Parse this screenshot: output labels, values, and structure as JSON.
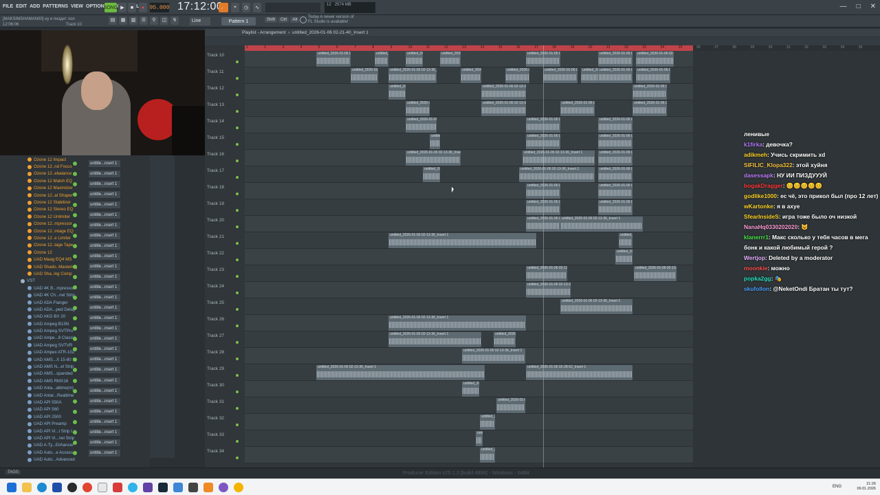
{
  "menu": [
    "FILE",
    "EDIT",
    "ADD",
    "PATTERNS",
    "VIEW",
    "OPTIONS",
    "TOOLS",
    "HELP"
  ],
  "transport": {
    "tempo": "95.000",
    "clock": "17:12:00",
    "song_label": "SONG"
  },
  "hint": {
    "line1": "[MAKSIMSHAMAN00] ну и пиздит лол",
    "line2": "12:06:06",
    "track": "Track 10"
  },
  "cpu": {
    "cpu": "12",
    "mem": "2574 MB"
  },
  "notice": {
    "line1": "Today  A newer version of",
    "line2": "FL Studio is available!"
  },
  "toolbar": {
    "pattern": "Pattern 1",
    "snap": "Line",
    "mods": [
      "Shift",
      "Ctrl",
      "Alt"
    ]
  },
  "playlist": {
    "title": "Playlist - Arrangement",
    "name": "untitled_2026-01-06 02-21-40_Insert 1"
  },
  "ruler": [
    "1",
    "2",
    "3",
    "4",
    "5",
    "6",
    "7",
    "8",
    "9",
    "10",
    "11",
    "12",
    "13",
    "14",
    "15",
    "16",
    "17",
    "18",
    "19",
    "20",
    "21",
    "22",
    "23",
    "24",
    "25",
    "26",
    "27",
    "28",
    "29",
    "30",
    "31",
    "32",
    "33",
    "34",
    "35"
  ],
  "tracks": [
    "Track 10",
    "Track 11",
    "Track 12",
    "Track 13",
    "Track 14",
    "Track 15",
    "Track 16",
    "Track 17",
    "Track 18",
    "Track 19",
    "Track 20",
    "Track 21",
    "Track 22",
    "Track 23",
    "Track 24",
    "Track 25",
    "Track 26",
    "Track 27",
    "Track 28",
    "Track 29",
    "Track 30",
    "Track 31",
    "Track 32",
    "Track 33",
    "Track 34"
  ],
  "browser_items": [
    {
      "label": "Ozone 12 Impact",
      "type": "orange"
    },
    {
      "label": "Ozone 12..nd Focus",
      "type": "orange"
    },
    {
      "label": "Ozone 12..ebalance",
      "type": "orange"
    },
    {
      "label": "Ozone 12 Match EQ",
      "type": "orange"
    },
    {
      "label": "Ozone 12 Maximizer",
      "type": "orange"
    },
    {
      "label": "Ozone 12..al Shaper",
      "type": "orange"
    },
    {
      "label": "Ozone 12 Stabilizer",
      "type": "orange"
    },
    {
      "label": "Ozone 12 Stereo EQ",
      "type": "orange"
    },
    {
      "label": "Ozone 12 Unlimiter",
      "type": "orange"
    },
    {
      "label": "Ozone 12..mpressor",
      "type": "orange"
    },
    {
      "label": "Ozone 12..intage EQ",
      "type": "orange"
    },
    {
      "label": "Ozone 12..e Limiter",
      "type": "orange"
    },
    {
      "label": "Ozone 12..tage Tape",
      "type": "orange"
    },
    {
      "label": "Ozone 12",
      "type": "orange"
    },
    {
      "label": "UAD Maag EQ4 MS",
      "type": "orange"
    },
    {
      "label": "UAD Shado..Mastering",
      "type": "orange"
    },
    {
      "label": "UAD Sha..ing Comp",
      "type": "orange"
    },
    {
      "label": "VST",
      "type": "vst"
    },
    {
      "label": "UAD 4K B...mpressor",
      "type": "blue"
    },
    {
      "label": "UAD 4K Ch...nel Strip",
      "type": "blue"
    },
    {
      "label": "UAD ADA Flanger",
      "type": "blue"
    },
    {
      "label": "UAD ADA...ped Delay",
      "type": "blue"
    },
    {
      "label": "UAD AKG BX 20",
      "type": "blue"
    },
    {
      "label": "UAD Ampeg B15N",
      "type": "blue"
    },
    {
      "label": "UAD Ampeg SVTPro",
      "type": "blue"
    },
    {
      "label": "UAD Ampe...8 Classic",
      "type": "blue"
    },
    {
      "label": "UAD Ampeg SVTVR",
      "type": "blue"
    },
    {
      "label": "UAD Ampex ATR-102",
      "type": "blue"
    },
    {
      "label": "UAD AMS...X 15-80 S",
      "type": "blue"
    },
    {
      "label": "UAD AMS N...el Strip",
      "type": "blue"
    },
    {
      "label": "UAD AMS...xpanded",
      "type": "blue"
    },
    {
      "label": "UAD AMS RMX16",
      "type": "blue"
    },
    {
      "label": "UAD Anta...altime(m)",
      "type": "blue"
    },
    {
      "label": "UAD Antar...Realtime",
      "type": "blue"
    },
    {
      "label": "UAD API 550A",
      "type": "blue"
    },
    {
      "label": "UAD API 560",
      "type": "blue"
    },
    {
      "label": "UAD API 2500",
      "type": "blue"
    },
    {
      "label": "UAD API Preamp",
      "type": "blue"
    },
    {
      "label": "UAD API Vi...l Strip Lw",
      "type": "blue"
    },
    {
      "label": "UAD API Vi...nel Strip",
      "type": "blue"
    },
    {
      "label": "UAD A-Ty...Enhancer",
      "type": "blue"
    },
    {
      "label": "UAD Auto...e Access",
      "type": "blue"
    },
    {
      "label": "UAD Auto...Advanced",
      "type": "blue"
    }
  ],
  "mixer_label": "untitle...nsert 1",
  "clip_label": "untitled_2026-01-06 02-13-36_Insert 1",
  "clip_label2": "untitled_2026-01-06 02-28-52_Insert 1",
  "statusbar": "Producer Edition v25.1.2 [build 4896] - Windows - 64Bit",
  "chat": [
    {
      "user": "",
      "color": "#ffffff",
      "text": "ленивые"
    },
    {
      "user": "k1firka",
      "color": "#b57bff",
      "text": ": девочка?"
    },
    {
      "user": "adikmeh",
      "color": "#ffd42a",
      "text": ": Учись скримить xd"
    },
    {
      "user": "SIFILIC_Klopa322",
      "color": "#f7c340",
      "text": ": этой хуйня"
    },
    {
      "user": "dasessapk",
      "color": "#c07fff",
      "text": ": НУ ИИ ПИЗДУУУЙ"
    },
    {
      "user": "bogakDragger",
      "color": "#ff3b3b",
      "text": ": 😊😊😊😊😊"
    },
    {
      "user": "godlike1000",
      "color": "#ffd42a",
      "text": ": ес чё, это прикол был (про 12 лет)"
    },
    {
      "user": "wKartonke",
      "color": "#ffd42a",
      "text": ": я в ахуе"
    },
    {
      "user": "SfearInsideS",
      "color": "#ffd42a",
      "text": ": игра тоже было оч низкой"
    },
    {
      "user": "NanaHq0330202020",
      "color": "#ff9ed6",
      "text": ": 😺"
    },
    {
      "user": "klanerrr1",
      "color": "#46e646",
      "text": ": Макс сколько у тебя часов в мега бонк и какой любимый герой ?"
    },
    {
      "user": "Wertjop",
      "color": "#e8b0ff",
      "text": ": Deleted by a moderator"
    },
    {
      "user": "moonkie",
      "color": "#ff5050",
      "text": ": можно"
    },
    {
      "user": "popka2gg",
      "color": "#29e0c0",
      "text": ": 🎭"
    },
    {
      "user": "skufollon",
      "color": "#4aa0ff",
      "text": ": @NeketOndi Братан ты тут?"
    }
  ],
  "tray": {
    "lang": "ENG",
    "time": "21:26",
    "date": "09.01.2026"
  },
  "colors": {
    "accent": "#c0434a",
    "orange": "#f0a030",
    "taskbar": "#f3f4f5"
  }
}
